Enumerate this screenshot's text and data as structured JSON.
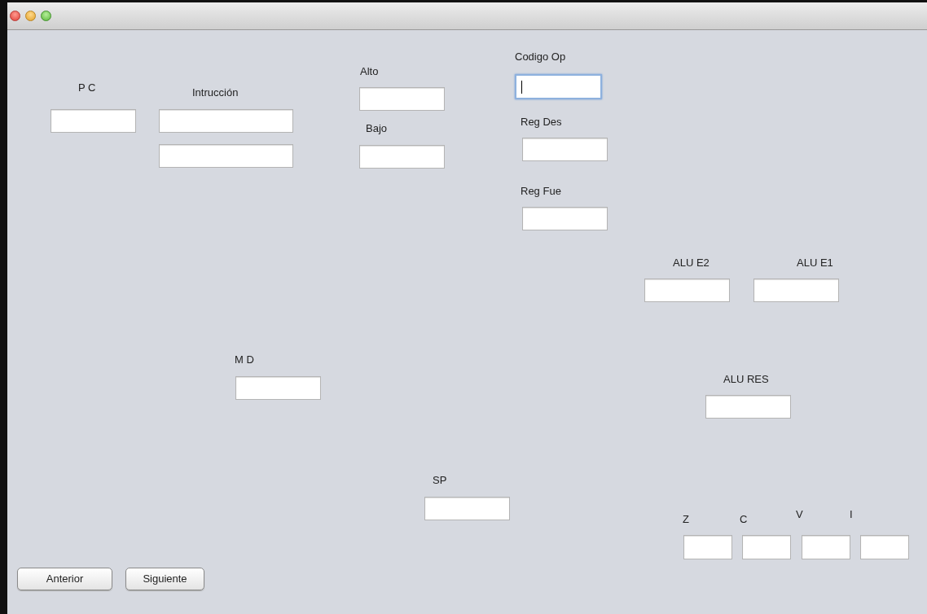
{
  "window": {
    "controls": [
      {
        "kind": "close"
      },
      {
        "kind": "minimize"
      },
      {
        "kind": "zoom"
      }
    ]
  },
  "labels": [
    "P C",
    "Intrucción",
    "Alto",
    "Bajo",
    "Codigo Op",
    "Reg Des",
    "Reg Fue",
    "ALU E2",
    "ALU E1",
    "M D",
    "ALU RES",
    "SP",
    "Z",
    "C",
    "V",
    "I"
  ],
  "fields": [
    {
      "focused": false
    },
    {
      "focused": false
    },
    {
      "focused": false
    },
    {
      "focused": false
    },
    {
      "focused": false
    },
    {
      "focused": true
    },
    {
      "focused": false
    },
    {
      "focused": false
    },
    {
      "focused": false
    },
    {
      "focused": false
    },
    {
      "focused": false
    },
    {
      "focused": false
    },
    {
      "focused": false
    },
    {
      "focused": false
    },
    {
      "focused": false
    },
    {
      "focused": false
    },
    {
      "focused": false
    }
  ],
  "buttons": [
    "Anterior",
    "Siguiente"
  ]
}
